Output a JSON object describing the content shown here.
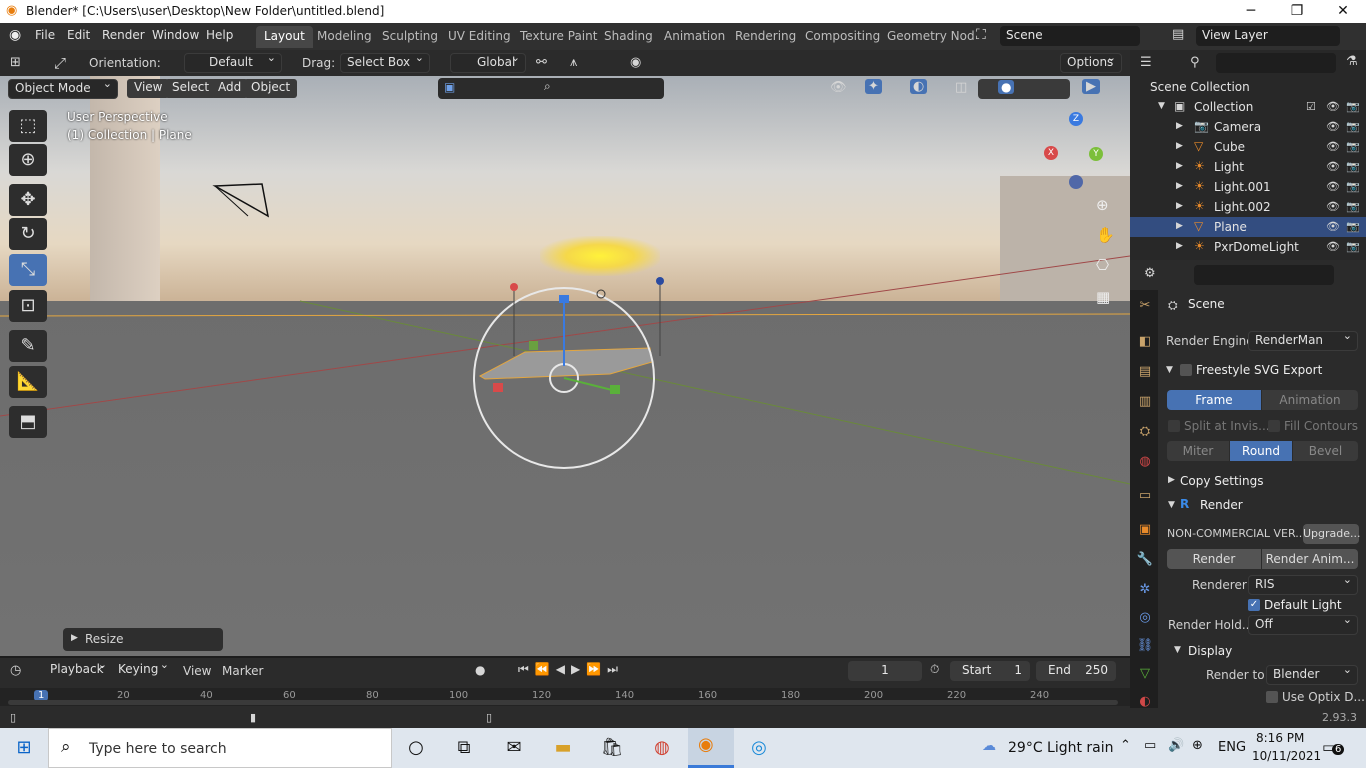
{
  "window": {
    "title": "Blender* [C:\\Users\\user\\Desktop\\New Folder\\untitled.blend]",
    "min": "─",
    "max": "❐",
    "close": "✕"
  },
  "menus": [
    "File",
    "Edit",
    "Render",
    "Window",
    "Help"
  ],
  "workspaces": [
    "Layout",
    "Modeling",
    "Sculpting",
    "UV Editing",
    "Texture Paint",
    "Shading",
    "Animation",
    "Rendering",
    "Compositing",
    "Geometry Nod"
  ],
  "scene": "Scene",
  "view_layer": "View Layer",
  "header": {
    "orientation_label": "Orientation:",
    "orientation_value": "Default",
    "drag_label": "Drag:",
    "drag_value": "Select Box",
    "transform_value": "Global",
    "options": "Options"
  },
  "viewport": {
    "mode": "Object Mode",
    "menus": [
      "View",
      "Select",
      "Add",
      "Object"
    ],
    "perspective": "User Perspective",
    "collection_text": "(1) Collection | Plane",
    "operator_panel": "Resize",
    "gizmo": {
      "x": "X",
      "y": "Y",
      "z": "Z"
    }
  },
  "outliner": {
    "root": "Scene Collection",
    "collection": "Collection",
    "items": [
      "Camera",
      "Cube",
      "Light",
      "Light.001",
      "Light.002",
      "Plane",
      "PxrDomeLight"
    ],
    "selected": "Plane"
  },
  "properties": {
    "scene_label": "Scene",
    "render_engine_label": "Render Engine",
    "render_engine_value": "RenderMan",
    "freestyle": "Freestyle SVG Export",
    "frame": "Frame",
    "animation": "Animation",
    "split": "Split at Invis...",
    "fill": "Fill Contours",
    "miter": "Miter",
    "round": "Round",
    "bevel": "Bevel",
    "copy": "Copy Settings",
    "render_panel": "Render",
    "noncommercial": "NON-COMMERCIAL VER...",
    "upgrade": "Upgrade...",
    "render_btn": "Render",
    "render_anim_btn": "Render Anim...",
    "renderer_label": "Renderer",
    "renderer_value": "RIS",
    "default_light": "Default Light",
    "render_hold_label": "Render Hold...",
    "render_hold_value": "Off",
    "display": "Display",
    "render_to_label": "Render to",
    "render_to_value": "Blender",
    "optix": "Use Optix D..."
  },
  "timeline": {
    "playback": "Playback",
    "keying": "Keying",
    "view": "View",
    "marker": "Marker",
    "current_frame": "1",
    "start_label": "Start",
    "start": "1",
    "end_label": "End",
    "end": "250",
    "ticks": [
      "1",
      "20",
      "40",
      "60",
      "80",
      "100",
      "120",
      "140",
      "160",
      "180",
      "200",
      "220",
      "240"
    ]
  },
  "statusbar": {
    "version": "2.93.3"
  },
  "taskbar": {
    "search_placeholder": "Type here to search",
    "weather": "29°C  Light rain",
    "lang": "ENG",
    "time": "8:16 PM",
    "date": "10/11/2021",
    "notif": "6"
  }
}
